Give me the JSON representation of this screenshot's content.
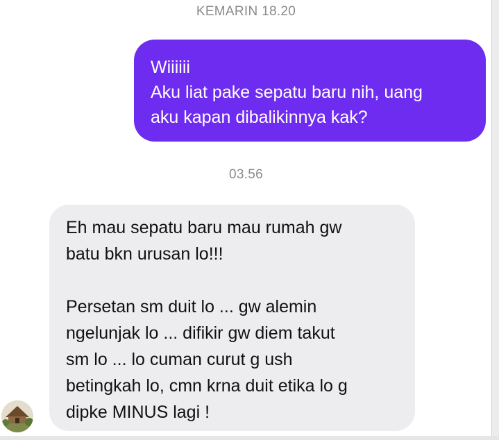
{
  "conversation": {
    "timestamp_1": "KEMARIN 18.20",
    "outgoing_message": {
      "lines": [
        "Wiiiiii",
        "Aku liat pake sepatu baru nih, uang",
        "aku kapan dibalikinnya kak?"
      ]
    },
    "timestamp_2": "03.56",
    "incoming_message": {
      "paragraph_1": [
        "Eh mau sepatu baru mau rumah gw",
        "batu bkn urusan lo!!!"
      ],
      "paragraph_2": [
        "Persetan sm duit lo ... gw alemin",
        "ngelunjak lo ... difikir gw diem takut",
        "sm lo ... lo cuman curut g ush",
        "betingkah lo, cmn krna duit etika lo g",
        "dipke MINUS lagi !"
      ]
    }
  },
  "colors": {
    "outgoing_bubble": "#6e2cf0",
    "incoming_bubble": "#ededf0",
    "timestamp_text": "#8a8a8e"
  },
  "avatar": {
    "icon": "contact-avatar-icon"
  }
}
